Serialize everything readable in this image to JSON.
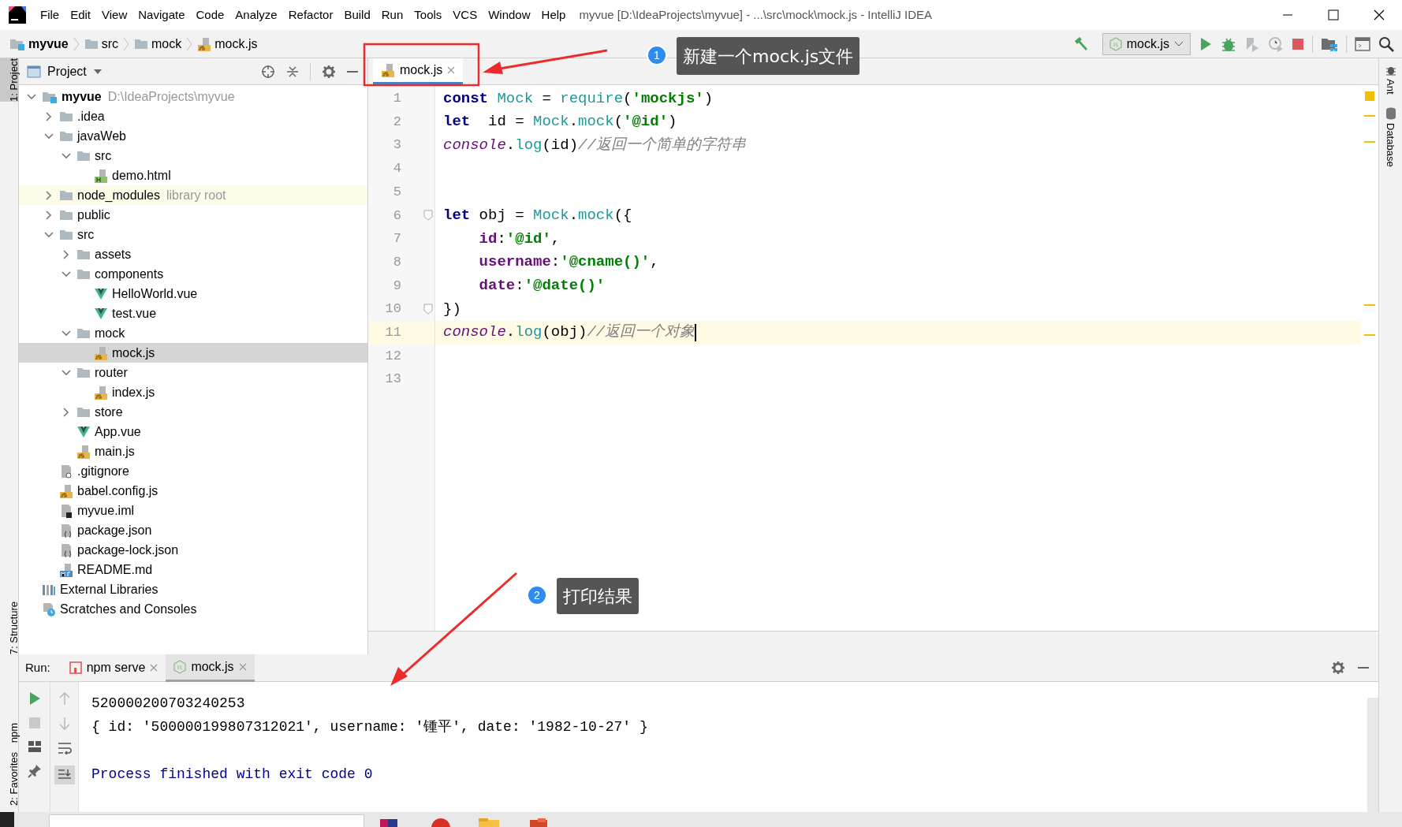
{
  "window": {
    "title": "myvue [D:\\IdeaProjects\\myvue] - ...\\src\\mock\\mock.js - IntelliJ IDEA",
    "menu": [
      "File",
      "Edit",
      "View",
      "Navigate",
      "Code",
      "Analyze",
      "Refactor",
      "Build",
      "Run",
      "Tools",
      "VCS",
      "Window",
      "Help"
    ]
  },
  "breadcrumb": [
    {
      "label": "myvue",
      "kind": "module"
    },
    {
      "label": "src",
      "kind": "folder"
    },
    {
      "label": "mock",
      "kind": "folder"
    },
    {
      "label": "mock.js",
      "kind": "js"
    }
  ],
  "toolbar": {
    "run_config": "mock.js"
  },
  "left_tool_windows": [
    {
      "label": "1: Project",
      "selected": true
    },
    {
      "label": "7: Structure",
      "selected": false
    },
    {
      "label": "npm",
      "selected": false
    },
    {
      "label": "2: Favorites",
      "selected": false
    }
  ],
  "right_tool_windows": [
    {
      "label": "Ant"
    },
    {
      "label": "Database"
    }
  ],
  "project_panel": {
    "title": "Project",
    "tree": [
      {
        "label": "myvue",
        "kind": "module",
        "hint": "D:\\IdeaProjects\\myvue",
        "expanded": true,
        "selected": false,
        "children": [
          {
            "label": ".idea",
            "kind": "folder",
            "expanded": false,
            "selected": false
          },
          {
            "label": "javaWeb",
            "kind": "folder",
            "expanded": true,
            "selected": false,
            "children": [
              {
                "label": "src",
                "kind": "folder",
                "expanded": true,
                "selected": false,
                "children": [
                  {
                    "label": "demo.html",
                    "kind": "html",
                    "selected": false
                  }
                ]
              }
            ]
          },
          {
            "label": "node_modules",
            "kind": "folder",
            "hint": "library root",
            "highlighted": true,
            "expanded": false,
            "selected": false
          },
          {
            "label": "public",
            "kind": "folder",
            "expanded": false,
            "selected": false
          },
          {
            "label": "src",
            "kind": "folder",
            "expanded": true,
            "selected": false,
            "children": [
              {
                "label": "assets",
                "kind": "folder",
                "expanded": false,
                "selected": false
              },
              {
                "label": "components",
                "kind": "folder",
                "expanded": true,
                "selected": false,
                "children": [
                  {
                    "label": "HelloWorld.vue",
                    "kind": "vue",
                    "selected": false
                  },
                  {
                    "label": "test.vue",
                    "kind": "vue",
                    "selected": false
                  }
                ]
              },
              {
                "label": "mock",
                "kind": "folder",
                "expanded": true,
                "selected": false,
                "children": [
                  {
                    "label": "mock.js",
                    "kind": "js",
                    "selected": true
                  }
                ]
              },
              {
                "label": "router",
                "kind": "folder",
                "expanded": true,
                "selected": false,
                "children": [
                  {
                    "label": "index.js",
                    "kind": "js",
                    "selected": false
                  }
                ]
              },
              {
                "label": "store",
                "kind": "folder",
                "expanded": false,
                "selected": false
              },
              {
                "label": "App.vue",
                "kind": "vue",
                "selected": false
              },
              {
                "label": "main.js",
                "kind": "js",
                "selected": false
              }
            ]
          },
          {
            "label": ".gitignore",
            "kind": "text",
            "selected": false
          },
          {
            "label": "babel.config.js",
            "kind": "js",
            "selected": false
          },
          {
            "label": "myvue.iml",
            "kind": "iml",
            "selected": false
          },
          {
            "label": "package.json",
            "kind": "json",
            "selected": false
          },
          {
            "label": "package-lock.json",
            "kind": "json",
            "selected": false
          },
          {
            "label": "README.md",
            "kind": "md",
            "selected": false
          }
        ]
      },
      {
        "label": "External Libraries",
        "kind": "libraries",
        "selected": false
      },
      {
        "label": "Scratches and Consoles",
        "kind": "scratches",
        "selected": false
      }
    ]
  },
  "editor": {
    "tabs": [
      {
        "label": "mock.js",
        "selected": true
      }
    ],
    "lines": [
      {
        "number": "1",
        "current": false,
        "tokens": [
          {
            "text": "const ",
            "kind": "keyword"
          },
          {
            "text": "Mock",
            "kind": "global"
          },
          {
            "text": " = ",
            "kind": "plain"
          },
          {
            "text": "require",
            "kind": "global"
          },
          {
            "text": "(",
            "kind": "plain"
          },
          {
            "text": "'mockjs'",
            "kind": "string"
          },
          {
            "text": ")",
            "kind": "plain"
          }
        ]
      },
      {
        "number": "2",
        "current": false,
        "tokens": [
          {
            "text": "let  ",
            "kind": "keyword"
          },
          {
            "text": "id = ",
            "kind": "plain"
          },
          {
            "text": "Mock",
            "kind": "global"
          },
          {
            "text": ".",
            "kind": "plain"
          },
          {
            "text": "mock",
            "kind": "global"
          },
          {
            "text": "(",
            "kind": "plain"
          },
          {
            "text": "'@id'",
            "kind": "string"
          },
          {
            "text": ")",
            "kind": "plain"
          }
        ]
      },
      {
        "number": "3",
        "current": false,
        "tokens": [
          {
            "text": "console",
            "kind": "object"
          },
          {
            "text": ".",
            "kind": "plain"
          },
          {
            "text": "log",
            "kind": "global"
          },
          {
            "text": "(id)",
            "kind": "plain"
          },
          {
            "text": "//返回一个简单的字符串",
            "kind": "comment"
          }
        ]
      },
      {
        "number": "4",
        "current": false
      },
      {
        "number": "5",
        "current": false
      },
      {
        "number": "6",
        "current": false,
        "fold": true,
        "tokens": [
          {
            "text": "let ",
            "kind": "keyword"
          },
          {
            "text": "obj = ",
            "kind": "plain"
          },
          {
            "text": "Mock",
            "kind": "global"
          },
          {
            "text": ".",
            "kind": "plain"
          },
          {
            "text": "mock",
            "kind": "global"
          },
          {
            "text": "({",
            "kind": "plain"
          }
        ]
      },
      {
        "number": "7",
        "current": false,
        "tokens": [
          {
            "text": "    id",
            "kind": "property"
          },
          {
            "text": ":",
            "kind": "plain"
          },
          {
            "text": "'@id'",
            "kind": "string"
          },
          {
            "text": ",",
            "kind": "plain"
          }
        ]
      },
      {
        "number": "8",
        "current": false,
        "tokens": [
          {
            "text": "    username",
            "kind": "property"
          },
          {
            "text": ":",
            "kind": "plain"
          },
          {
            "text": "'@cname()'",
            "kind": "string"
          },
          {
            "text": ",",
            "kind": "plain"
          }
        ]
      },
      {
        "number": "9",
        "current": false,
        "tokens": [
          {
            "text": "    date",
            "kind": "property"
          },
          {
            "text": ":",
            "kind": "plain"
          },
          {
            "text": "'@date()'",
            "kind": "string"
          }
        ]
      },
      {
        "number": "10",
        "current": false,
        "fold": true,
        "tokens": [
          {
            "text": "})",
            "kind": "plain"
          }
        ]
      },
      {
        "number": "11",
        "current": true,
        "tokens": [
          {
            "text": "console",
            "kind": "object"
          },
          {
            "text": ".",
            "kind": "plain"
          },
          {
            "text": "log",
            "kind": "global"
          },
          {
            "text": "(obj)",
            "kind": "plain"
          },
          {
            "text": "//返回一个对象",
            "kind": "comment"
          }
        ]
      },
      {
        "number": "12",
        "current": false
      },
      {
        "number": "13",
        "current": false
      }
    ]
  },
  "run_panel": {
    "label": "Run:",
    "tabs": [
      {
        "label": "npm serve",
        "kind": "npm",
        "selected": false
      },
      {
        "label": "mock.js",
        "kind": "node",
        "selected": true
      }
    ],
    "output": [
      {
        "text": "520000200703240253",
        "kind": "stdout"
      },
      {
        "text": "{ id: '500000199807312021', username: '锺平', date: '1982-10-27' }",
        "kind": "stdout"
      },
      {
        "text": "Process finished with exit code 0",
        "kind": "system"
      }
    ]
  },
  "annotations": [
    {
      "number": "1",
      "text": "新建一个mock.js文件"
    },
    {
      "number": "2",
      "text": "打印结果"
    }
  ]
}
